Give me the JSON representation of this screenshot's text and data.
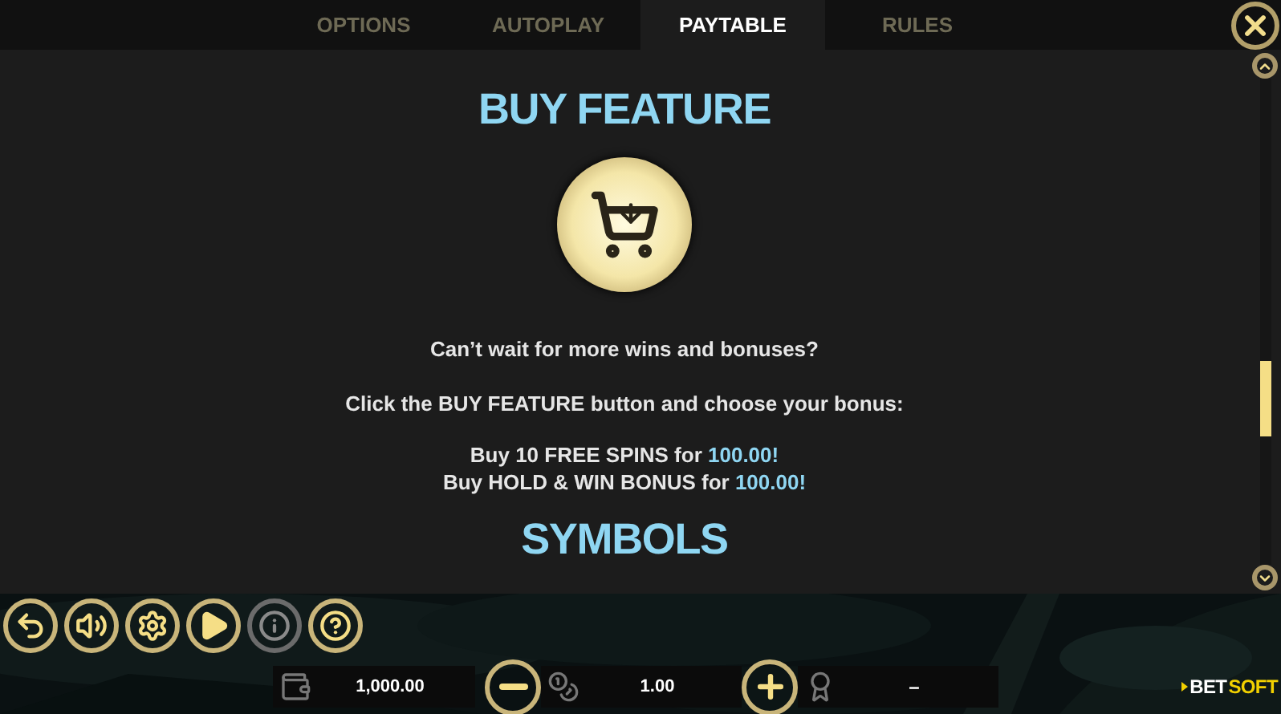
{
  "tabs": [
    {
      "label": "OPTIONS",
      "selected": false
    },
    {
      "label": "AUTOPLAY",
      "selected": false
    },
    {
      "label": "PAYTABLE",
      "selected": true
    },
    {
      "label": "RULES",
      "selected": false
    }
  ],
  "sections": [
    {
      "kind": "heading",
      "text": "BUY FEATURE"
    },
    {
      "kind": "cart_icon"
    },
    {
      "kind": "paragraph",
      "text": "Can’t wait for more wins and bonuses?"
    },
    {
      "kind": "paragraph",
      "text": "Click the BUY FEATURE button and choose your bonus:"
    },
    {
      "kind": "offers",
      "lines": [
        {
          "text": "Buy 10 FREE SPINS for ",
          "price": "100.00!"
        },
        {
          "text": "Buy HOLD & WIN BONUS for ",
          "price": "100.00!"
        }
      ]
    },
    {
      "kind": "heading",
      "text": "SYMBOLS"
    }
  ],
  "toolbar": [
    {
      "kind": "back",
      "disabled": false
    },
    {
      "kind": "sound",
      "disabled": false
    },
    {
      "kind": "settings",
      "disabled": false
    },
    {
      "kind": "autoplay",
      "disabled": false
    },
    {
      "kind": "info",
      "disabled": true
    },
    {
      "kind": "help",
      "disabled": false
    }
  ],
  "balance": {
    "value": "1,000.00"
  },
  "bet": {
    "value": "1.00"
  },
  "win": {
    "value": "–"
  },
  "logo": {
    "part_1": "BET",
    "part_2": "SOFT"
  }
}
